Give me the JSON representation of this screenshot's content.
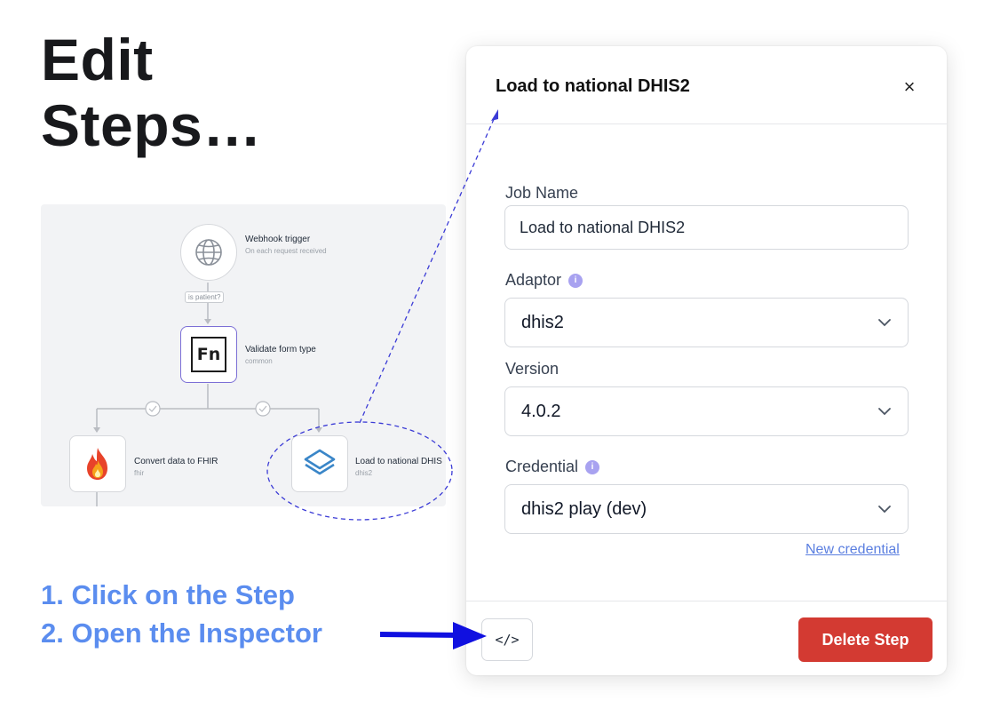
{
  "headline": {
    "line1": "Edit",
    "line2": "Steps…"
  },
  "canvas": {
    "nodes": [
      {
        "title": "Webhook trigger",
        "subtitle": "On each request received",
        "icon": "globe-icon"
      },
      {
        "title": "Validate form type",
        "subtitle": "common",
        "icon": "fn-icon",
        "icon_text": "Fn"
      },
      {
        "title": "Convert data to FHIR",
        "subtitle": "fhir",
        "icon": "fire-icon"
      },
      {
        "title": "Load to national DHIS",
        "subtitle": "dhis2",
        "icon": "layers-icon"
      }
    ],
    "edge_label": "is patient?"
  },
  "instructions": {
    "step1": "1. Click on the Step",
    "step2": "2. Open the Inspector"
  },
  "inspector": {
    "title": "Load to national DHIS2",
    "close_icon": "×",
    "job_name": {
      "label": "Job Name",
      "value": "Load to national DHIS2"
    },
    "adaptor": {
      "label": "Adaptor",
      "value": "dhis2"
    },
    "version": {
      "label": "Version",
      "value": "4.0.2"
    },
    "credential": {
      "label": "Credential",
      "value": "dhis2 play (dev)"
    },
    "info_icon_glyph": "i",
    "new_credential": "New credential",
    "code_button_glyph": "</>",
    "delete_button": "Delete Step"
  },
  "colors": {
    "instruction_blue": "#5b8def",
    "delete_red": "#d33a32",
    "annotation_blue": "#3b3bd6",
    "arrow_blue": "#1010e0",
    "selected_node": "#7c6fd6"
  }
}
